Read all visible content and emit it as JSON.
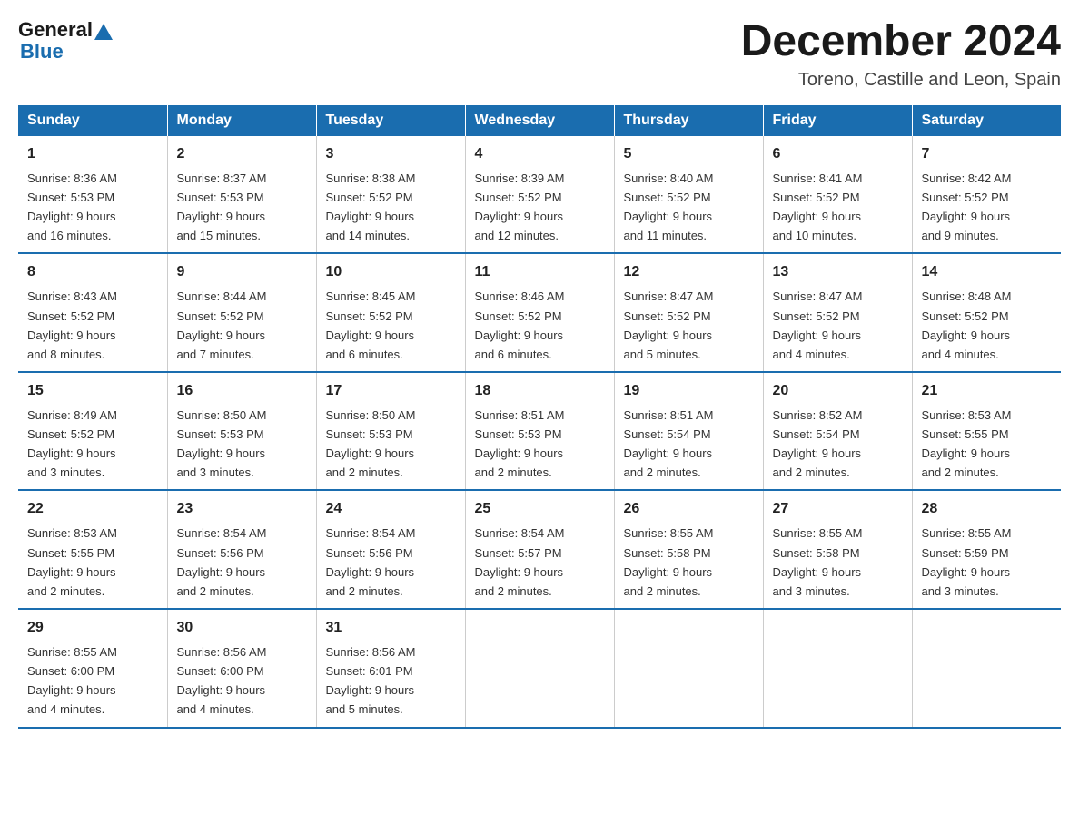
{
  "header": {
    "logo_general": "General",
    "logo_blue": "Blue",
    "title": "December 2024",
    "subtitle": "Toreno, Castille and Leon, Spain"
  },
  "days_of_week": [
    "Sunday",
    "Monday",
    "Tuesday",
    "Wednesday",
    "Thursday",
    "Friday",
    "Saturday"
  ],
  "weeks": [
    [
      {
        "day": "1",
        "sunrise": "8:36 AM",
        "sunset": "5:53 PM",
        "daylight": "9 hours and 16 minutes."
      },
      {
        "day": "2",
        "sunrise": "8:37 AM",
        "sunset": "5:53 PM",
        "daylight": "9 hours and 15 minutes."
      },
      {
        "day": "3",
        "sunrise": "8:38 AM",
        "sunset": "5:52 PM",
        "daylight": "9 hours and 14 minutes."
      },
      {
        "day": "4",
        "sunrise": "8:39 AM",
        "sunset": "5:52 PM",
        "daylight": "9 hours and 12 minutes."
      },
      {
        "day": "5",
        "sunrise": "8:40 AM",
        "sunset": "5:52 PM",
        "daylight": "9 hours and 11 minutes."
      },
      {
        "day": "6",
        "sunrise": "8:41 AM",
        "sunset": "5:52 PM",
        "daylight": "9 hours and 10 minutes."
      },
      {
        "day": "7",
        "sunrise": "8:42 AM",
        "sunset": "5:52 PM",
        "daylight": "9 hours and 9 minutes."
      }
    ],
    [
      {
        "day": "8",
        "sunrise": "8:43 AM",
        "sunset": "5:52 PM",
        "daylight": "9 hours and 8 minutes."
      },
      {
        "day": "9",
        "sunrise": "8:44 AM",
        "sunset": "5:52 PM",
        "daylight": "9 hours and 7 minutes."
      },
      {
        "day": "10",
        "sunrise": "8:45 AM",
        "sunset": "5:52 PM",
        "daylight": "9 hours and 6 minutes."
      },
      {
        "day": "11",
        "sunrise": "8:46 AM",
        "sunset": "5:52 PM",
        "daylight": "9 hours and 6 minutes."
      },
      {
        "day": "12",
        "sunrise": "8:47 AM",
        "sunset": "5:52 PM",
        "daylight": "9 hours and 5 minutes."
      },
      {
        "day": "13",
        "sunrise": "8:47 AM",
        "sunset": "5:52 PM",
        "daylight": "9 hours and 4 minutes."
      },
      {
        "day": "14",
        "sunrise": "8:48 AM",
        "sunset": "5:52 PM",
        "daylight": "9 hours and 4 minutes."
      }
    ],
    [
      {
        "day": "15",
        "sunrise": "8:49 AM",
        "sunset": "5:52 PM",
        "daylight": "9 hours and 3 minutes."
      },
      {
        "day": "16",
        "sunrise": "8:50 AM",
        "sunset": "5:53 PM",
        "daylight": "9 hours and 3 minutes."
      },
      {
        "day": "17",
        "sunrise": "8:50 AM",
        "sunset": "5:53 PM",
        "daylight": "9 hours and 2 minutes."
      },
      {
        "day": "18",
        "sunrise": "8:51 AM",
        "sunset": "5:53 PM",
        "daylight": "9 hours and 2 minutes."
      },
      {
        "day": "19",
        "sunrise": "8:51 AM",
        "sunset": "5:54 PM",
        "daylight": "9 hours and 2 minutes."
      },
      {
        "day": "20",
        "sunrise": "8:52 AM",
        "sunset": "5:54 PM",
        "daylight": "9 hours and 2 minutes."
      },
      {
        "day": "21",
        "sunrise": "8:53 AM",
        "sunset": "5:55 PM",
        "daylight": "9 hours and 2 minutes."
      }
    ],
    [
      {
        "day": "22",
        "sunrise": "8:53 AM",
        "sunset": "5:55 PM",
        "daylight": "9 hours and 2 minutes."
      },
      {
        "day": "23",
        "sunrise": "8:54 AM",
        "sunset": "5:56 PM",
        "daylight": "9 hours and 2 minutes."
      },
      {
        "day": "24",
        "sunrise": "8:54 AM",
        "sunset": "5:56 PM",
        "daylight": "9 hours and 2 minutes."
      },
      {
        "day": "25",
        "sunrise": "8:54 AM",
        "sunset": "5:57 PM",
        "daylight": "9 hours and 2 minutes."
      },
      {
        "day": "26",
        "sunrise": "8:55 AM",
        "sunset": "5:58 PM",
        "daylight": "9 hours and 2 minutes."
      },
      {
        "day": "27",
        "sunrise": "8:55 AM",
        "sunset": "5:58 PM",
        "daylight": "9 hours and 3 minutes."
      },
      {
        "day": "28",
        "sunrise": "8:55 AM",
        "sunset": "5:59 PM",
        "daylight": "9 hours and 3 minutes."
      }
    ],
    [
      {
        "day": "29",
        "sunrise": "8:55 AM",
        "sunset": "6:00 PM",
        "daylight": "9 hours and 4 minutes."
      },
      {
        "day": "30",
        "sunrise": "8:56 AM",
        "sunset": "6:00 PM",
        "daylight": "9 hours and 4 minutes."
      },
      {
        "day": "31",
        "sunrise": "8:56 AM",
        "sunset": "6:01 PM",
        "daylight": "9 hours and 5 minutes."
      },
      null,
      null,
      null,
      null
    ]
  ],
  "labels": {
    "sunrise": "Sunrise:",
    "sunset": "Sunset:",
    "daylight": "Daylight:"
  }
}
